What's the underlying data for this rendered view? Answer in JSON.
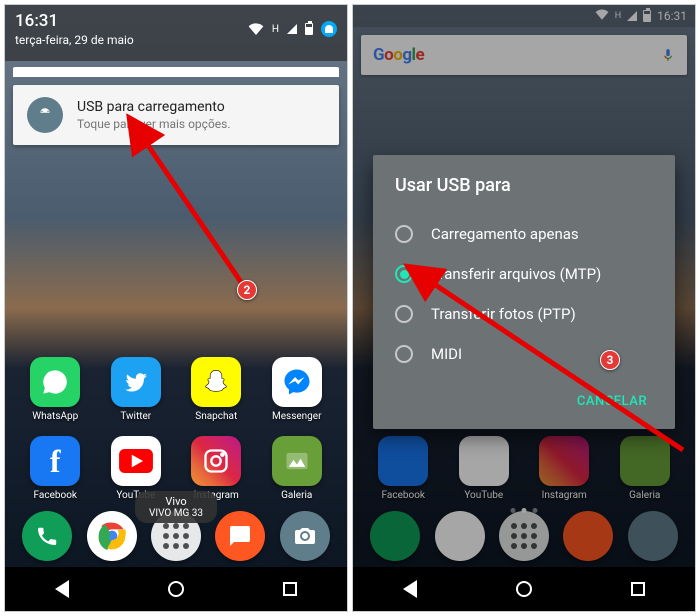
{
  "status": {
    "time": "16:31",
    "date": "terça-feira, 29 de maio",
    "network_indicator": "H"
  },
  "notification": {
    "title": "USB para carregamento",
    "subtitle": "Toque para ver mais opções."
  },
  "search": {
    "logo": "Google"
  },
  "apps_row1": [
    {
      "label": "WhatsApp"
    },
    {
      "label": "Twitter"
    },
    {
      "label": "Snapchat"
    },
    {
      "label": "Messenger"
    }
  ],
  "apps_row2": [
    {
      "label": "Facebook"
    },
    {
      "label": "YouTube"
    },
    {
      "label": "Instagram"
    },
    {
      "label": "Galeria"
    }
  ],
  "carrier": {
    "line1": "Vivo",
    "line2": "VIVO MG 33"
  },
  "dialog": {
    "title": "Usar USB para",
    "options": [
      {
        "label": "Carregamento apenas",
        "selected": false
      },
      {
        "label": "Transferir arquivos (MTP)",
        "selected": true
      },
      {
        "label": "Transferir fotos (PTP)",
        "selected": false
      },
      {
        "label": "MIDI",
        "selected": false
      }
    ],
    "cancel": "CANCELAR"
  },
  "annotations": {
    "badge_left": "2",
    "badge_right": "3"
  }
}
